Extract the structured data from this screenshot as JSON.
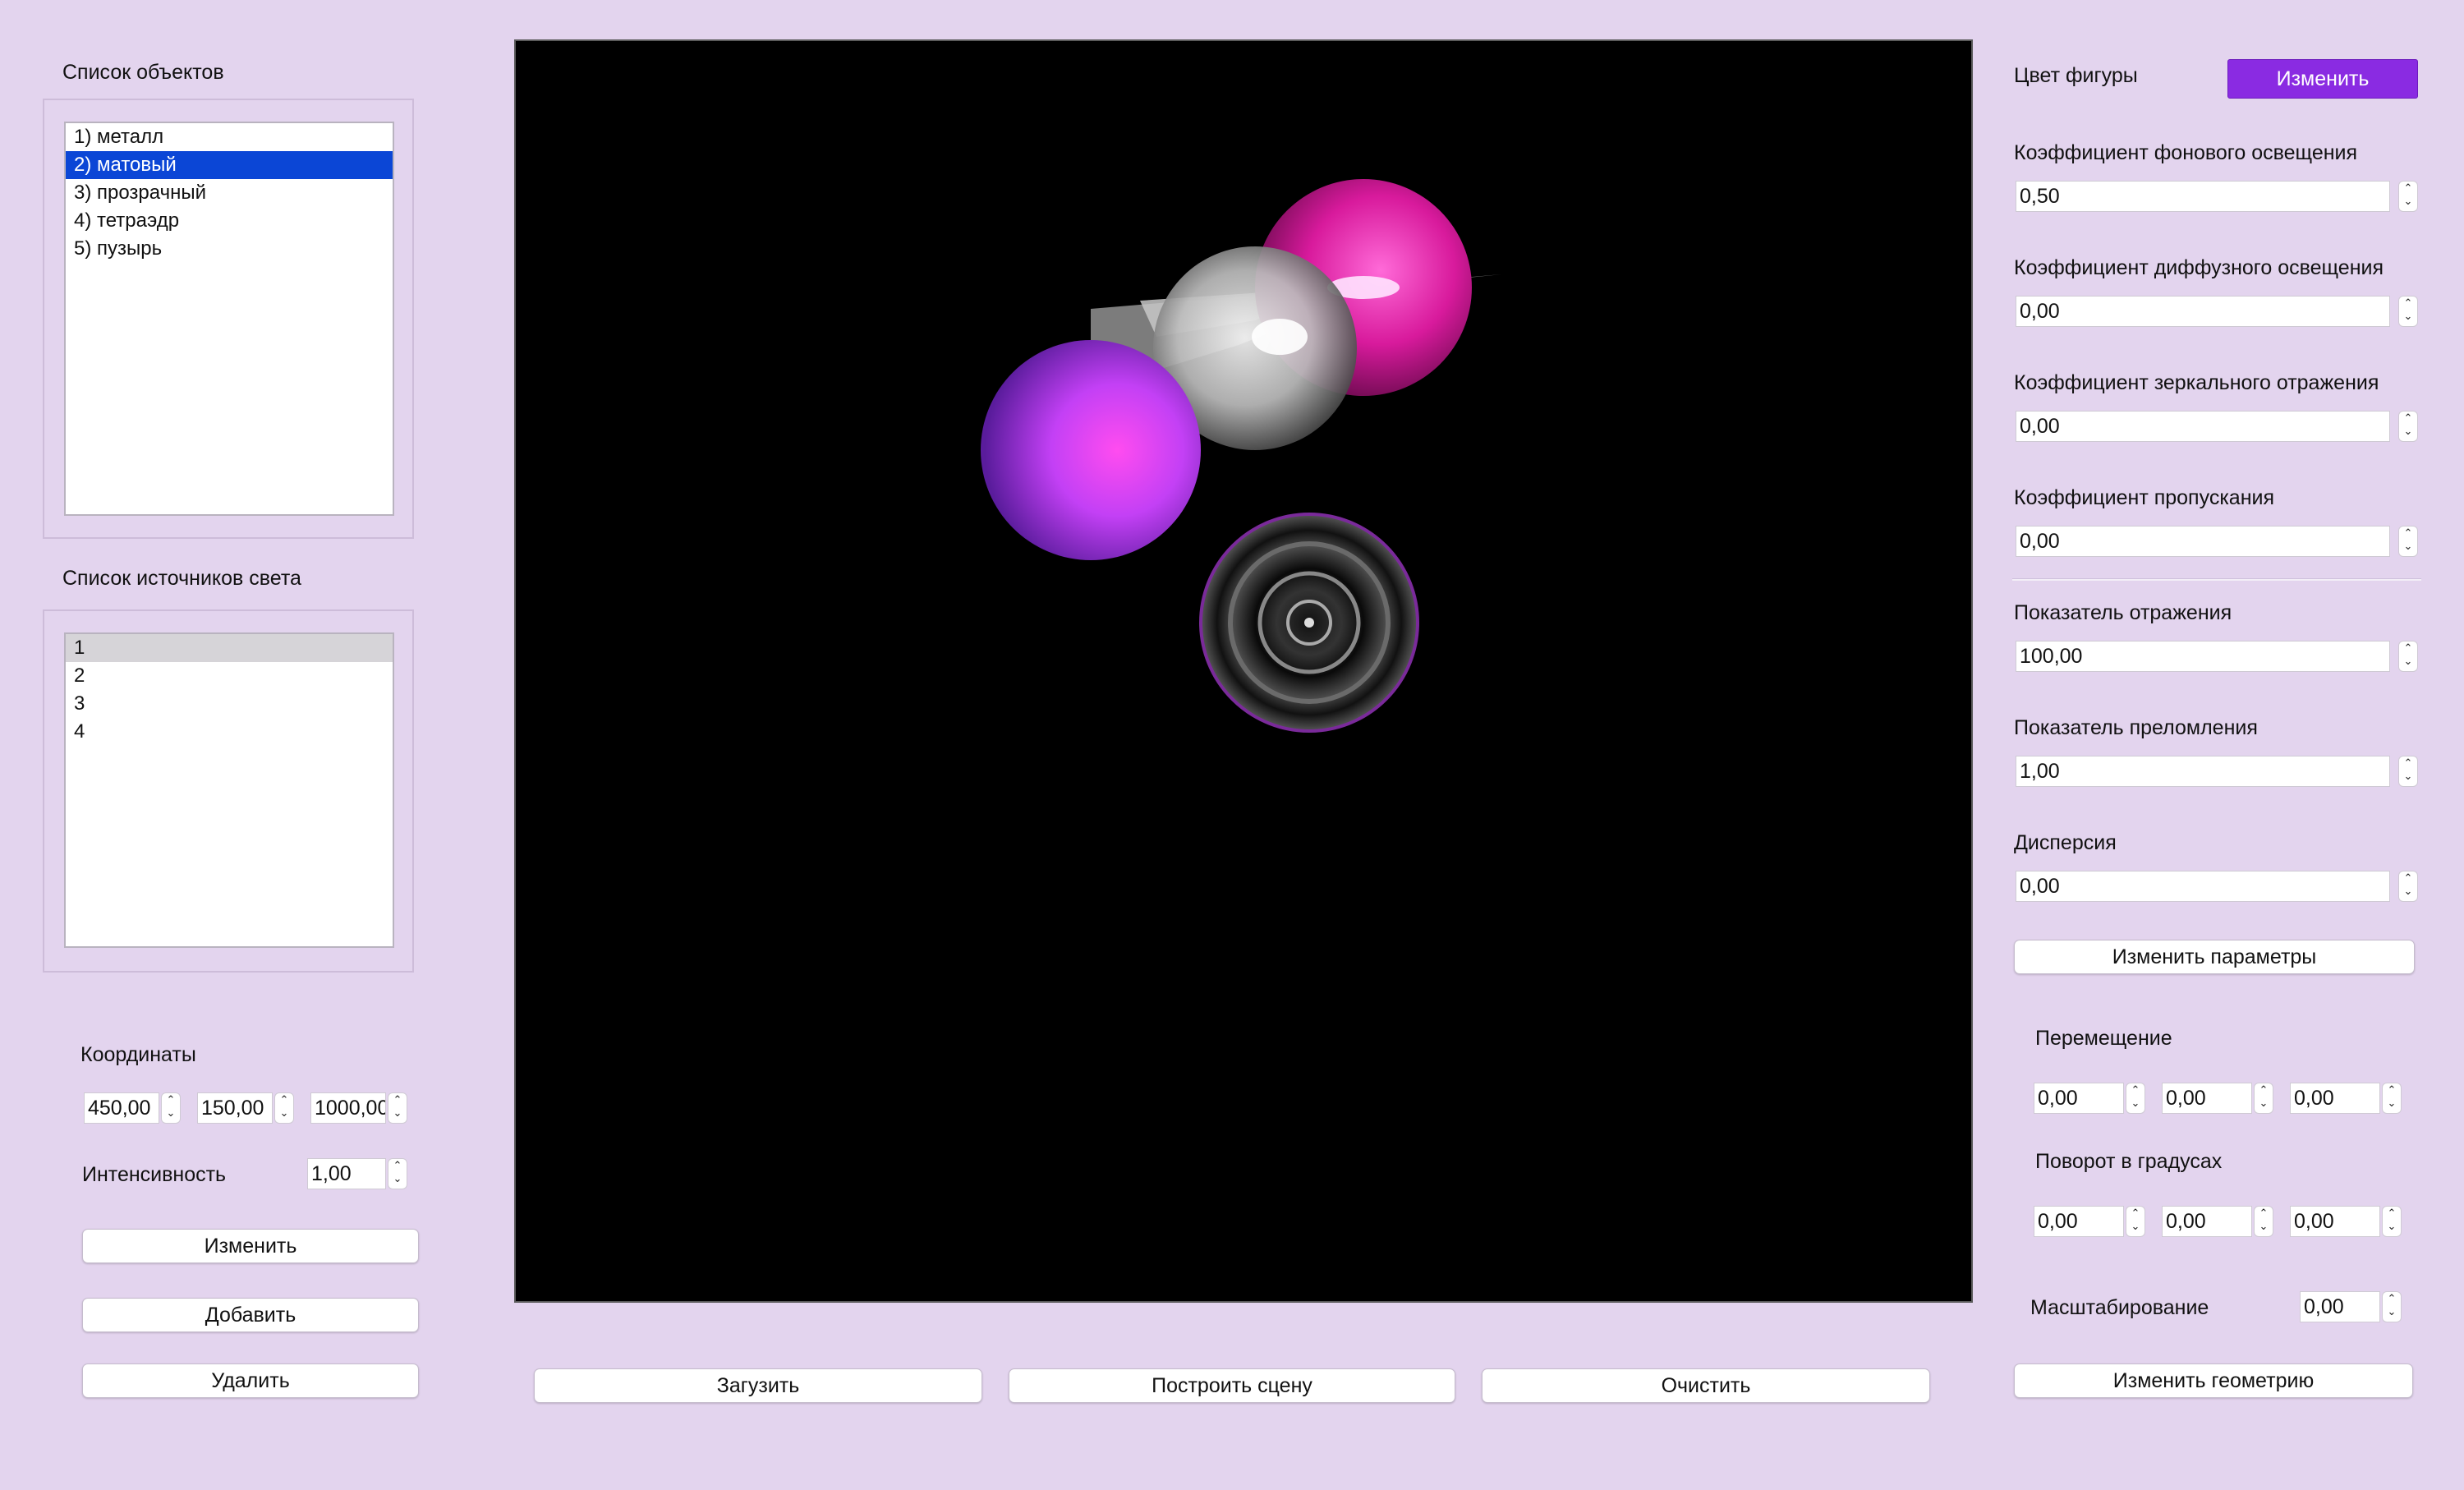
{
  "objects_panel": {
    "title": "Список объектов",
    "items": [
      {
        "label": "1) металл",
        "state": "normal"
      },
      {
        "label": "2) матовый",
        "state": "selected"
      },
      {
        "label": "3) прозрачный",
        "state": "normal"
      },
      {
        "label": "4) тетраэдр",
        "state": "normal"
      },
      {
        "label": "5) пузырь",
        "state": "normal"
      }
    ]
  },
  "lights_panel": {
    "title": "Список источников света",
    "items": [
      {
        "label": "1",
        "state": "highlighted"
      },
      {
        "label": "2",
        "state": "normal"
      },
      {
        "label": "3",
        "state": "normal"
      },
      {
        "label": "4",
        "state": "normal"
      }
    ]
  },
  "light_editor": {
    "coords_label": "Координаты",
    "x": "450,00",
    "y": "150,00",
    "z": "1000,00",
    "intensity_label": "Интенсивность",
    "intensity": "1,00",
    "change_button": "Изменить",
    "add_button": "Добавить",
    "delete_button": "Удалить"
  },
  "scene_buttons": {
    "load": "Загузить",
    "build": "Построить сцену",
    "clear": "Очистить"
  },
  "material": {
    "color_label": "Цвет фигуры",
    "color_button": "Изменить",
    "color_button_bg": "#8a2be2",
    "ambient_label": "Коэффициент фонового освещения",
    "ambient": "0,50",
    "diffuse_label": "Коэффициент диффузного освещения",
    "diffuse": "0,00",
    "specular_label": "Коэффициент зеркального отражения",
    "specular": "0,00",
    "transmission_label": "Коэффициент пропускания",
    "transmission": "0,00",
    "reflection_exp_label": "Показатель отражения",
    "reflection_exp": "100,00",
    "refraction_label": "Показатель преломления",
    "refraction": "1,00",
    "dispersion_label": "Дисперсия",
    "dispersion": "0,00",
    "apply_button": "Изменить параметры"
  },
  "geometry": {
    "move_label": "Перемещение",
    "move": [
      "0,00",
      "0,00",
      "0,00"
    ],
    "rotate_label": "Поворот в градусах",
    "rotate": [
      "0,00",
      "0,00",
      "0,00"
    ],
    "scale_label": "Масштабирование",
    "scale": "0,00",
    "apply_button": "Изменить геометрию"
  },
  "colors": {
    "window_bg": "#e3d4ee",
    "selection": "#0b46d6",
    "accent_purple": "#8a2be2",
    "viewport_bg": "#000000"
  }
}
